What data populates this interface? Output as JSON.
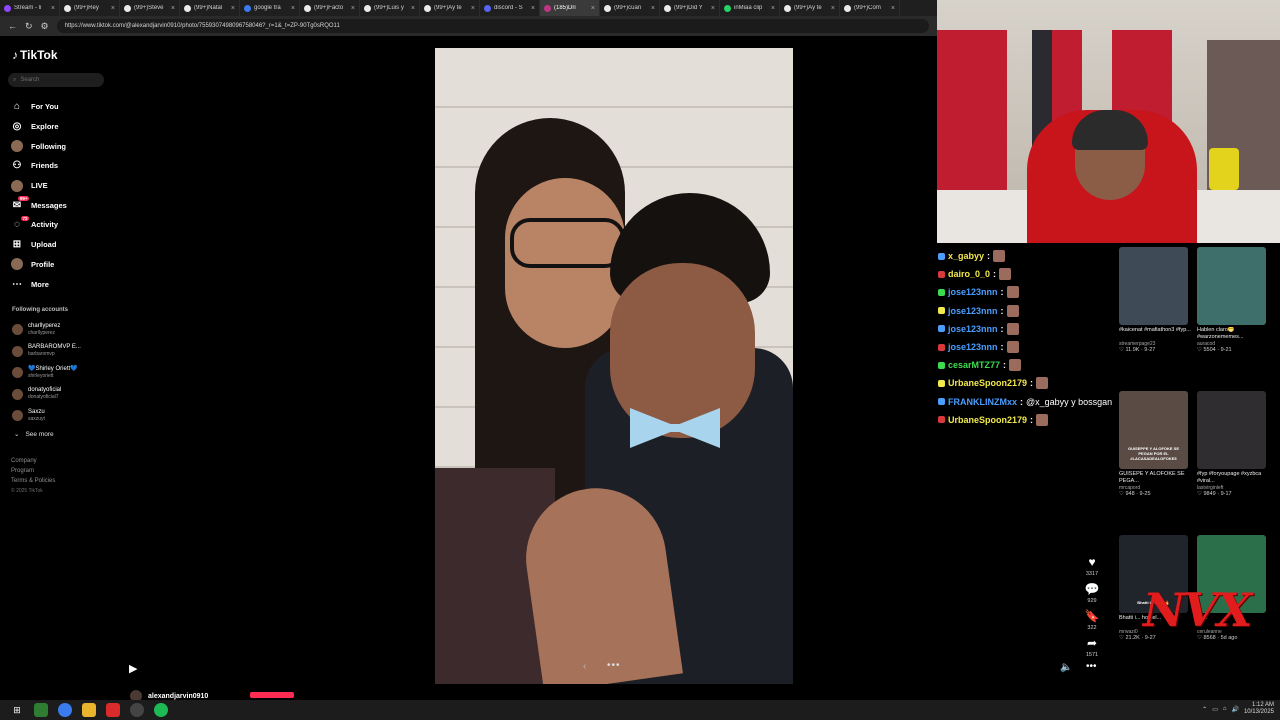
{
  "browser": {
    "tabs": [
      {
        "title": "Stream - li",
        "icon": "stream-icon"
      },
      {
        "title": "(99+)Rey",
        "icon": "tiktok-icon"
      },
      {
        "title": "(99+)Steve",
        "icon": "tiktok-icon"
      },
      {
        "title": "(99+)Natal",
        "icon": "tiktok-icon"
      },
      {
        "title": "google tra",
        "icon": "google-icon"
      },
      {
        "title": "(99+)Facto",
        "icon": "tiktok-icon"
      },
      {
        "title": "(99+)Luis y",
        "icon": "tiktok-icon"
      },
      {
        "title": "(99+)Ay te",
        "icon": "tiktok-icon"
      },
      {
        "title": "discord - S",
        "icon": "discord-icon"
      },
      {
        "title": "(185)Dri",
        "icon": "instagram-icon"
      },
      {
        "title": "(99+)cuan",
        "icon": "tiktok-icon"
      },
      {
        "title": "(99+)Did Y",
        "icon": "tiktok-icon"
      },
      {
        "title": "inMiaa clip",
        "icon": "whatsapp-icon"
      },
      {
        "title": "(99+)Ay te",
        "icon": "tiktok-icon"
      },
      {
        "title": "(99+)Com",
        "icon": "tiktok-icon"
      }
    ],
    "url": "https://www.tiktok.com/@alexandjarvin0910/photo/7559307498096758046?_r=1&_t=ZP-90Tg0sRQO11"
  },
  "sidebar": {
    "logo": "TikTok",
    "search_placeholder": "Search",
    "menu": [
      {
        "label": "For You",
        "icon": "home-icon"
      },
      {
        "label": "Explore",
        "icon": "compass-icon"
      },
      {
        "label": "Following",
        "icon": "following-avatar-icon"
      },
      {
        "label": "Friends",
        "icon": "friends-icon"
      },
      {
        "label": "LIVE",
        "icon": "live-avatar-icon"
      },
      {
        "label": "Messages",
        "icon": "messages-icon",
        "badge": "99+"
      },
      {
        "label": "Activity",
        "icon": "activity-icon",
        "badge": "72"
      },
      {
        "label": "Upload",
        "icon": "upload-icon"
      },
      {
        "label": "Profile",
        "icon": "profile-avatar-icon"
      },
      {
        "label": "More",
        "icon": "more-icon"
      }
    ],
    "following_title": "Following accounts",
    "following": [
      {
        "name": "charllyperez",
        "handle": "charllyperez"
      },
      {
        "name": "BARBAROMVP E...",
        "handle": "barbaromvp"
      },
      {
        "name": "💙Shirley Oriett💙",
        "handle": "shirleyoriett"
      },
      {
        "name": "donatyoficial",
        "handle": "donatyoficial7"
      },
      {
        "name": "Saxzu",
        "handle": "saxzuyt"
      }
    ],
    "see_more": "See more",
    "footer": [
      "Company",
      "Program",
      "Terms & Policies"
    ],
    "copyright": "© 2025 TikTok"
  },
  "post": {
    "author": "alexandjarvin0910",
    "dots": "•••"
  },
  "actions": {
    "likes": "3317",
    "comments": "929",
    "saves": "322",
    "shares": "1571"
  },
  "chat": [
    {
      "user": "x_gabyy",
      "color": "#f2e94e",
      "msg": ""
    },
    {
      "user": "dairo_0_0",
      "color": "#f2e94e",
      "msg": ""
    },
    {
      "user": "jose123nnn",
      "color": "#4a9eff",
      "msg": ""
    },
    {
      "user": "jose123nnn",
      "color": "#4a9eff",
      "msg": ""
    },
    {
      "user": "jose123nnn",
      "color": "#4a9eff",
      "msg": ""
    },
    {
      "user": "jose123nnn",
      "color": "#4a9eff",
      "msg": ""
    },
    {
      "user": "cesarMTZ77",
      "color": "#3ddc4e",
      "msg": ""
    },
    {
      "user": "UrbaneSpoon2179",
      "color": "#f2e94e",
      "msg": ""
    },
    {
      "user": "FRANKLINZMxx",
      "color": "#4a9eff",
      "msg": "@x_gabyy y bossgan"
    },
    {
      "user": "UrbaneSpoon2179",
      "color": "#f2e94e",
      "msg": ""
    }
  ],
  "videos": [
    {
      "title": "#kaicenat #mafiathon3 #fyp...",
      "user": "streamerpage23",
      "stats": "♡ 11.9K · 9-27",
      "caption": ""
    },
    {
      "title": "Hablen claro😁 #warzonememes...",
      "user": "auracod",
      "stats": "♡ 5504 · 9-21",
      "caption": ""
    },
    {
      "title": "GUISEPE Y ALOFOKE SE PEGA...",
      "user": "mrcapord",
      "stats": "♡ 948 · 9-25",
      "caption": "GUISEPPE Y ALOFOKE SE PEGAN POR EL #LACASADEALOFOKE5"
    },
    {
      "title": "#fyp #foryoupage #xyzbca #viral...",
      "user": "lastvirginleft",
      "stats": "♡ 9849 · 9-17",
      "caption": ""
    },
    {
      "title": "Bhatti i... hostel...",
      "user": "mrwazi0",
      "stats": "♡ 21.2K · 9-27",
      "caption": "Bhatti is Back 🔥"
    },
    {
      "title": "... ...",
      "user": "ceruleanne",
      "stats": "♡ 8568 · 5d ago",
      "caption": ""
    }
  ],
  "overlay": {
    "watermark": "NVX"
  },
  "taskbar": {
    "time": "1:12 AM",
    "date": "10/13/2025"
  }
}
